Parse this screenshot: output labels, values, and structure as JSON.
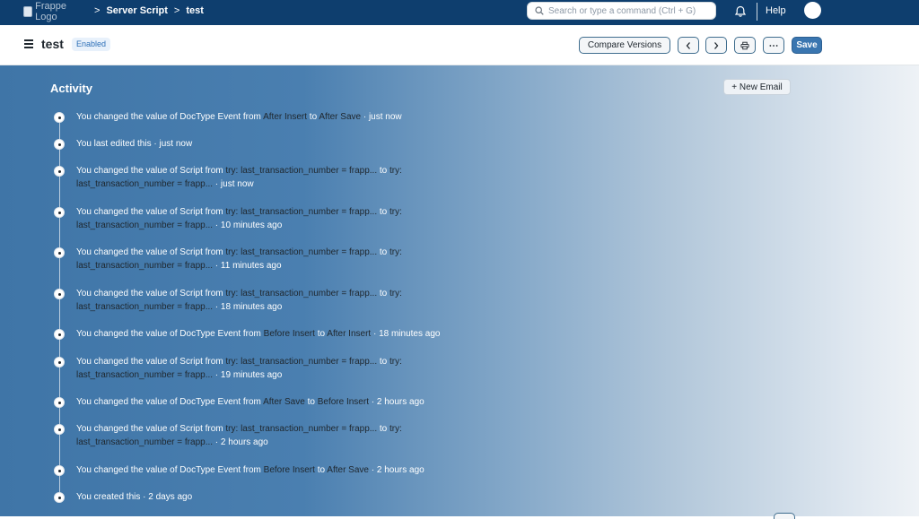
{
  "navbar": {
    "logo_alt": "Frappe Logo",
    "breadcrumbs": [
      "Server Script",
      "test"
    ],
    "breadcrumb_separator": ">",
    "search_placeholder": "Search or type a command (Ctrl + G)",
    "help_label": "Help"
  },
  "page": {
    "title": "test",
    "status_badge": "Enabled",
    "buttons": {
      "compare": "Compare Versions",
      "prev": "‹",
      "next": "›",
      "print": "🖶",
      "more": "···",
      "save": "Save"
    }
  },
  "activity": {
    "heading": "Activity",
    "new_email_label": "+ New Email",
    "items": [
      {
        "line1": [
          "You changed the value of DocType Event from ",
          {
            "v": "After Insert"
          },
          " to ",
          {
            "v": "After Save"
          },
          {
            "t": " · just now"
          }
        ],
        "line2": null
      },
      {
        "line1": [
          "You last edited this",
          {
            "t": " · just now"
          }
        ],
        "line2": null
      },
      {
        "line1": [
          "You changed the value of Script from ",
          {
            "v": "try: last_transaction_number = frapp..."
          },
          " to ",
          {
            "v": "try:"
          }
        ],
        "line2": [
          {
            "v": "last_transaction_number = frapp..."
          },
          {
            "t": " · just now"
          }
        ]
      },
      {
        "line1": [
          "You changed the value of Script from ",
          {
            "v": "try: last_transaction_number = frapp..."
          },
          " to ",
          {
            "v": "try:"
          }
        ],
        "line2": [
          {
            "v": "last_transaction_number = frapp..."
          },
          {
            "t": " · 10 minutes ago"
          }
        ]
      },
      {
        "line1": [
          "You changed the value of Script from ",
          {
            "v": "try: last_transaction_number = frapp..."
          },
          " to ",
          {
            "v": "try:"
          }
        ],
        "line2": [
          {
            "v": "last_transaction_number = frapp..."
          },
          {
            "t": " · 11 minutes ago"
          }
        ]
      },
      {
        "line1": [
          "You changed the value of Script from ",
          {
            "v": "try: last_transaction_number = frapp..."
          },
          " to ",
          {
            "v": "try:"
          }
        ],
        "line2": [
          {
            "v": "last_transaction_number = frapp..."
          },
          {
            "t": " · 18 minutes ago"
          }
        ]
      },
      {
        "line1": [
          "You changed the value of DocType Event from ",
          {
            "v": "Before Insert"
          },
          " to ",
          {
            "v": "After Insert"
          },
          {
            "t": " · 18 minutes ago"
          }
        ],
        "line2": null
      },
      {
        "line1": [
          "You changed the value of Script from ",
          {
            "v": "try: last_transaction_number = frapp..."
          },
          " to ",
          {
            "v": "try:"
          }
        ],
        "line2": [
          {
            "v": "last_transaction_number = frapp..."
          },
          {
            "t": " · 19 minutes ago"
          }
        ]
      },
      {
        "line1": [
          "You changed the value of DocType Event from ",
          {
            "v": "After Save"
          },
          " to ",
          {
            "v": "Before Insert"
          },
          {
            "t": " · 2 hours ago"
          }
        ],
        "line2": null
      },
      {
        "line1": [
          "You changed the value of Script from ",
          {
            "v": "try: last_transaction_number = frapp..."
          },
          " to ",
          {
            "v": "try:"
          }
        ],
        "line2": [
          {
            "v": "last_transaction_number = frapp..."
          },
          {
            "t": " · 2 hours ago"
          }
        ]
      },
      {
        "line1": [
          "You changed the value of DocType Event from ",
          {
            "v": "Before Insert"
          },
          " to ",
          {
            "v": "After Save"
          },
          {
            "t": " · 2 hours ago"
          }
        ],
        "line2": null
      },
      {
        "line1": [
          "You created this",
          {
            "t": " · 2 days ago"
          }
        ],
        "line2": null
      }
    ]
  }
}
